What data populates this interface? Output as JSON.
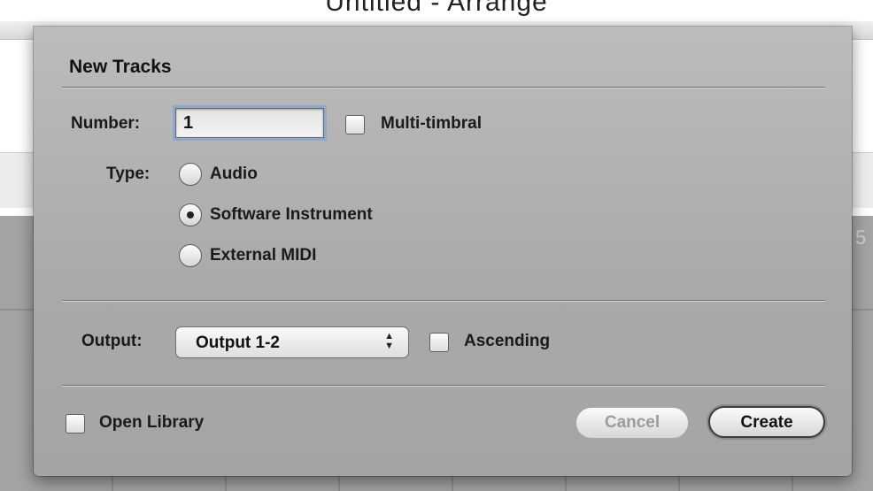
{
  "window": {
    "title": "Untitled - Arrange"
  },
  "background": {
    "ruler_number": "5"
  },
  "dialog": {
    "title": "New Tracks",
    "number": {
      "label": "Number:",
      "value": "1"
    },
    "multi_timbral": {
      "label": "Multi-timbral",
      "checked": false
    },
    "type": {
      "label": "Type:",
      "options": [
        "Audio",
        "Software Instrument",
        "External MIDI"
      ],
      "selected": "Software Instrument"
    },
    "output": {
      "label": "Output:",
      "value": "Output 1-2",
      "arrows_icon": "up-down-chevron-icon"
    },
    "ascending": {
      "label": "Ascending",
      "checked": false
    },
    "open_library": {
      "label": "Open Library",
      "checked": false
    },
    "buttons": {
      "cancel": "Cancel",
      "create": "Create"
    }
  }
}
